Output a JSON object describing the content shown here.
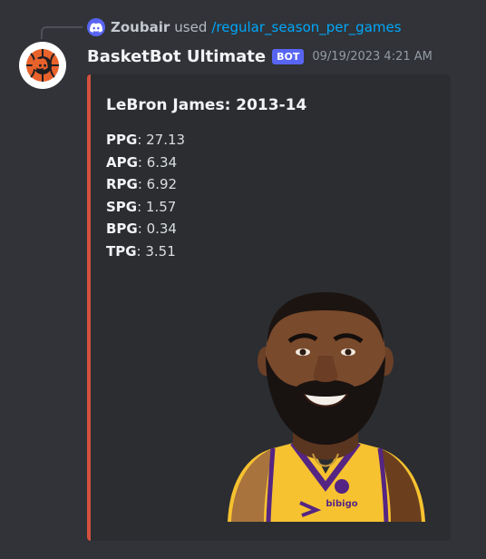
{
  "reply": {
    "user": "Zoubair",
    "used": "used",
    "command": "/regular_season_per_games"
  },
  "author": {
    "name": "BasketBot Ultimate",
    "tag": "BOT",
    "timestamp": "09/19/2023 4:21 AM"
  },
  "embed": {
    "accent_color": "#d4503e",
    "title": "LeBron James: 2013-14",
    "stats": [
      {
        "label": "PPG",
        "value": ": 27.13"
      },
      {
        "label": "APG",
        "value": ": 6.34"
      },
      {
        "label": "RPG",
        "value": ": 6.92"
      },
      {
        "label": "SPG",
        "value": ": 1.57"
      },
      {
        "label": "BPG",
        "value": ": 0.34"
      },
      {
        "label": "TPG",
        "value": ": 3.51"
      }
    ],
    "jersey_text": "bibigo"
  },
  "colors": {
    "background": "#313338",
    "embed_background": "#2b2d31",
    "link": "#00a8fc",
    "bot_tag": "#5865f2"
  }
}
